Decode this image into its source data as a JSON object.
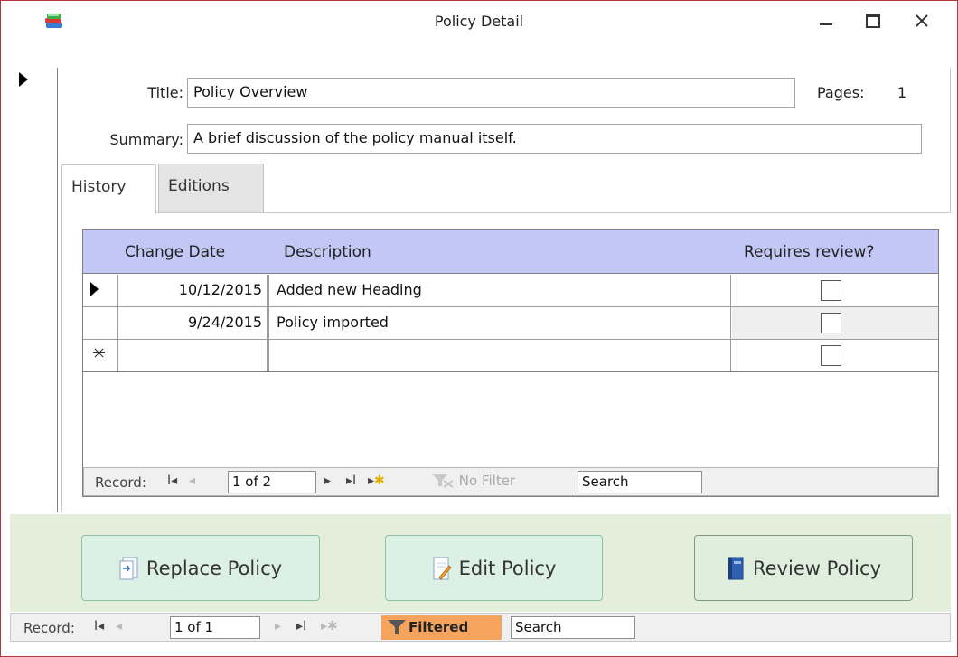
{
  "window": {
    "title": "Policy Detail",
    "icon": "app-books-icon"
  },
  "form": {
    "title_label": "Title:",
    "title_value": "Policy Overview",
    "pages_label": "Pages:",
    "pages_value": "1",
    "summary_label": "Summary:",
    "summary_value": "A brief discussion of the policy manual itself."
  },
  "tabs": [
    {
      "label": "History",
      "active": true
    },
    {
      "label": "Editions",
      "active": false
    }
  ],
  "datasheet": {
    "columns": [
      "Change Date",
      "Description",
      "Requires review?"
    ],
    "rows": [
      {
        "selector": "current",
        "date": "10/12/2015",
        "description": "Added new Heading",
        "requires_review": false
      },
      {
        "selector": "",
        "date": "9/24/2015",
        "description": "Policy imported",
        "requires_review": false
      },
      {
        "selector": "new",
        "date": "",
        "description": "",
        "requires_review": false
      }
    ],
    "new_row_glyph": "✳"
  },
  "subform_nav": {
    "record_label": "Record:",
    "position": "1 of 2",
    "filter_label": "No Filter",
    "search_placeholder": "Search"
  },
  "buttons": {
    "replace": "Replace Policy",
    "edit": "Edit Policy",
    "review": "Review Policy"
  },
  "main_nav": {
    "record_label": "Record:",
    "position": "1 of 1",
    "filter_label": "Filtered",
    "search_placeholder": "Search"
  },
  "colors": {
    "window_border": "#b0373f",
    "datasheet_header": "#c3c7f5",
    "footer_bg": "#e3eedb",
    "filtered_badge": "#f5a35d"
  }
}
